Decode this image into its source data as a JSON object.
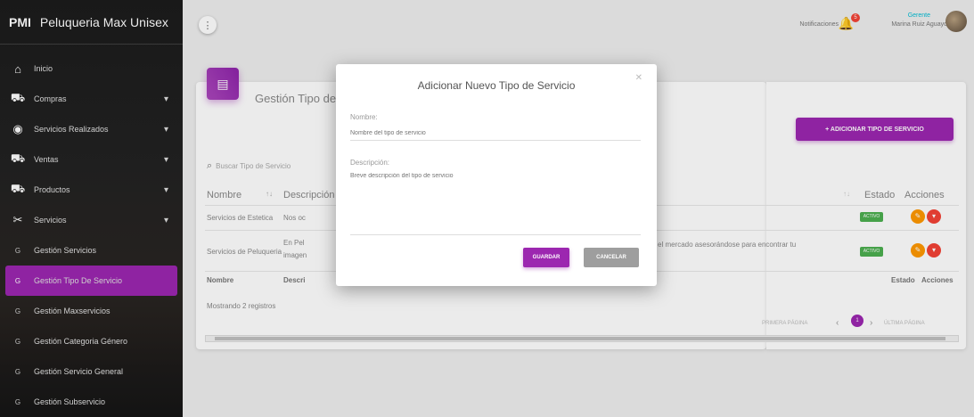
{
  "sidebar": {
    "abbr": "PMI",
    "title": "Peluqueria Max Unisex",
    "items": [
      {
        "label": "Inicio",
        "icon": "home-icon",
        "caret": ""
      },
      {
        "label": "Compras",
        "icon": "cart-icon",
        "caret": "▾"
      },
      {
        "label": "Servicios Realizados",
        "icon": "service-icon",
        "caret": "▾"
      },
      {
        "label": "Ventas",
        "icon": "cart-icon",
        "caret": "▾"
      },
      {
        "label": "Productos",
        "icon": "cart-icon",
        "caret": "▾"
      },
      {
        "label": "Servicios",
        "icon": "scissors-icon",
        "caret": "▾"
      },
      {
        "label": "Gestión Servicios",
        "sub": "G"
      },
      {
        "label": "Gestión Tipo De Servicio",
        "sub": "G",
        "active": true
      },
      {
        "label": "Gestión Maxservicios",
        "sub": "G"
      },
      {
        "label": "Gestión Categoria Género",
        "sub": "G"
      },
      {
        "label": "Gestión Servicio General",
        "sub": "G"
      },
      {
        "label": "Gestión Subservicio",
        "sub": "G"
      }
    ]
  },
  "topbar": {
    "notifications_label": "Notificaciones",
    "notifications_count": "5",
    "user_role": "Gerente",
    "user_name": "Marina Ruiz Aguayo"
  },
  "card": {
    "title": "Gestión Tipo de Servicio",
    "add_button": "+ ADICIONAR TIPO DE SERVICIO",
    "search_placeholder": "Buscar Tipo de Servicio",
    "headers": {
      "name": "Nombre",
      "desc": "Descripción",
      "status": "Estado",
      "actions": "Acciones"
    },
    "rows": [
      {
        "name": "Servicios de Estetica",
        "desc": "Nos oc",
        "status": "ACTIVO"
      },
      {
        "name": "Servicios de Peluqueria",
        "desc": "En Pel",
        "desc2": "imagen",
        "desc_tail": "el mercado asesorándose para encontrar tu",
        "status": "ACTIVO"
      }
    ],
    "footer": {
      "name": "Nombre",
      "desc": "Descri",
      "status": "Estado",
      "actions": "Acciones"
    },
    "count": "Mostrando 2 registros",
    "pager": {
      "first": "PRIMERA PÁGINA",
      "current": "1",
      "last": "ÚLTIMA PÁGINA"
    }
  },
  "modal": {
    "title": "Adicionar Nuevo Tipo de Servicio",
    "name_label": "Nombre:",
    "name_placeholder": "Nombre del tipo de servicio",
    "desc_label": "Descripción:",
    "desc_placeholder": "Breve descripción del tipo de servicio",
    "save": "GUARDAR",
    "cancel": "CANCELAR"
  },
  "colors": {
    "accent": "#9c27b0",
    "active": "#4caf50",
    "edit": "#ff9800",
    "delete": "#f44336"
  }
}
